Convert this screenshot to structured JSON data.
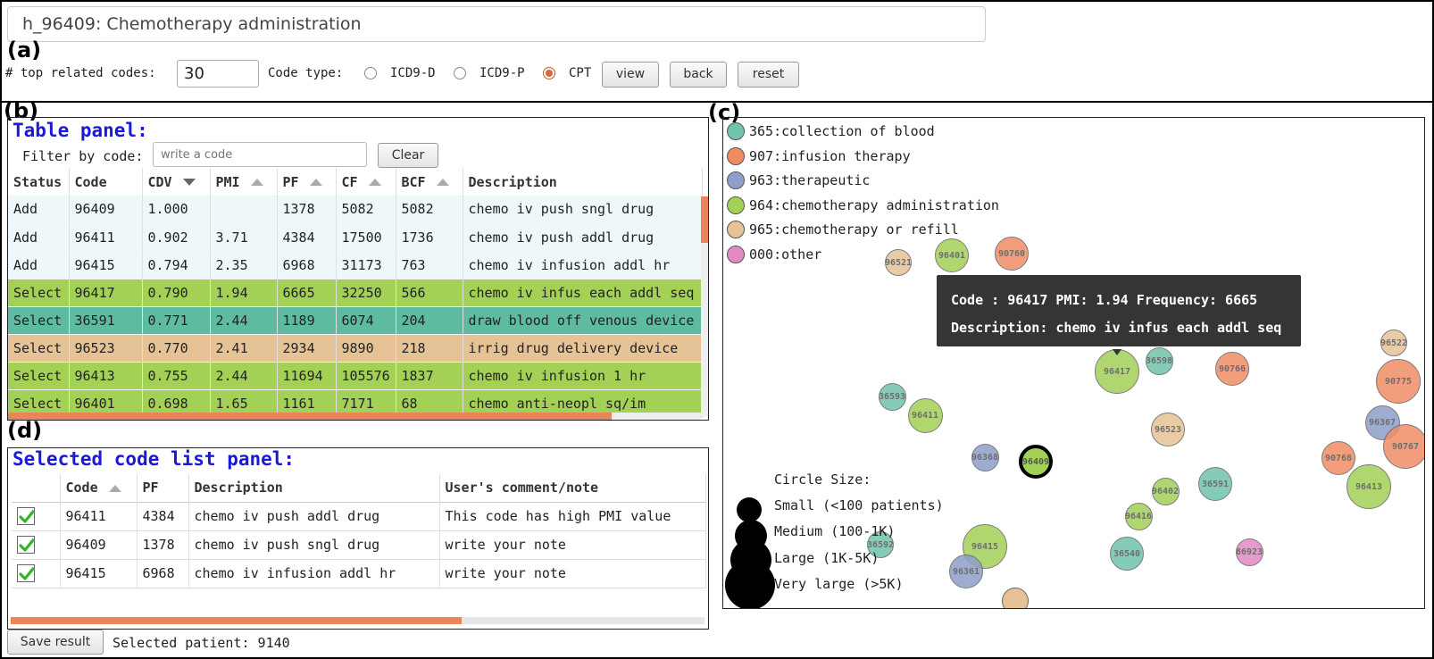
{
  "concept_title": "h_96409: Chemotherapy administration",
  "panel_letters": {
    "a": "(a)",
    "b": "(b)",
    "c": "(c)",
    "d": "(d)"
  },
  "controls": {
    "top_codes_label": "# top related codes:",
    "top_codes_value": "30",
    "code_type_label": "Code type:",
    "code_types": [
      "ICD9-D",
      "ICD9-P",
      "CPT"
    ],
    "selected_code_type": "CPT",
    "view_button": "view",
    "back_button": "back",
    "reset_button": "reset"
  },
  "table_panel": {
    "title": "Table panel:",
    "filter_label": "Filter by code:",
    "filter_placeholder": "write a code",
    "clear_button": "Clear",
    "columns": [
      "Status",
      "Code",
      "CDV",
      "PMI",
      "PF",
      "CF",
      "BCF",
      "Description"
    ],
    "sort_column": "CDV",
    "sort_direction": "descending",
    "rows": [
      {
        "status": "Add",
        "code": "96409",
        "cdv": "1.000",
        "pmi": "",
        "pf": "1378",
        "cf": "5082",
        "bcf": "5082",
        "description": "chemo iv push sngl drug",
        "color": "#eef7fa"
      },
      {
        "status": "Add",
        "code": "96411",
        "cdv": "0.902",
        "pmi": "3.71",
        "pf": "4384",
        "cf": "17500",
        "bcf": "1736",
        "description": "chemo iv push addl drug",
        "color": "#eef7fa"
      },
      {
        "status": "Add",
        "code": "96415",
        "cdv": "0.794",
        "pmi": "2.35",
        "pf": "6968",
        "cf": "31173",
        "bcf": "763",
        "description": "chemo iv infusion addl hr",
        "color": "#eef7fa"
      },
      {
        "status": "Select",
        "code": "96417",
        "cdv": "0.790",
        "pmi": "1.94",
        "pf": "6665",
        "cf": "32250",
        "bcf": "566",
        "description": "chemo iv infus each addl seq",
        "color": "#a3d156"
      },
      {
        "status": "Select",
        "code": "36591",
        "cdv": "0.771",
        "pmi": "2.44",
        "pf": "1189",
        "cf": "6074",
        "bcf": "204",
        "description": "draw blood off venous device",
        "color": "#5fbaa2"
      },
      {
        "status": "Select",
        "code": "96523",
        "cdv": "0.770",
        "pmi": "2.41",
        "pf": "2934",
        "cf": "9890",
        "bcf": "218",
        "description": "irrig drug delivery device",
        "color": "#e6c396"
      },
      {
        "status": "Select",
        "code": "96413",
        "cdv": "0.755",
        "pmi": "2.44",
        "pf": "11694",
        "cf": "105576",
        "bcf": "1837",
        "description": "chemo iv infusion 1 hr",
        "color": "#a3d156"
      },
      {
        "status": "Select",
        "code": "96401",
        "cdv": "0.698",
        "pmi": "1.65",
        "pf": "1161",
        "cf": "7171",
        "bcf": "68",
        "description": "chemo anti-neopl sq/im",
        "color": "#a3d156"
      }
    ]
  },
  "selected_panel": {
    "title": "Selected code list panel:",
    "columns": [
      "Code",
      "PF",
      "Description",
      "User's comment/note"
    ],
    "rows": [
      {
        "checked": true,
        "code": "96411",
        "pf": "4384",
        "description": "chemo iv push addl drug",
        "note": "This code has high PMI value"
      },
      {
        "checked": true,
        "code": "96409",
        "pf": "1378",
        "description": "chemo iv push sngl drug",
        "note": "write your note"
      },
      {
        "checked": true,
        "code": "96415",
        "pf": "6968",
        "description": "chemo iv infusion addl hr",
        "note": "write your note"
      }
    ],
    "save_button": "Save result",
    "selected_patient": "Selected patient: 9140"
  },
  "visualization": {
    "legend": [
      {
        "label": "365:collection of blood",
        "color": "#6fc4ab"
      },
      {
        "label": "907:infusion therapy",
        "color": "#f08c64"
      },
      {
        "label": "963:therapeutic",
        "color": "#8e9ecb"
      },
      {
        "label": "964:chemotherapy administration",
        "color": "#a3d156"
      },
      {
        "label": "965:chemotherapy or refill",
        "color": "#e6c396"
      },
      {
        "label": "000:other",
        "color": "#e38ac4"
      }
    ],
    "size_legend": {
      "title": "Circle Size:",
      "items": [
        "Small (<100 patients)",
        "Medium (100-1K)",
        "Large (1K-5K)",
        "Very large (>5K)"
      ]
    },
    "bubbles": [
      {
        "code": "96521",
        "group": "965"
      },
      {
        "code": "96401",
        "group": "964"
      },
      {
        "code": "90760",
        "group": "907"
      },
      {
        "code": "96522",
        "group": "965"
      },
      {
        "code": "96417",
        "group": "964"
      },
      {
        "code": "36598",
        "group": "365"
      },
      {
        "code": "90766",
        "group": "907"
      },
      {
        "code": "90775",
        "group": "907"
      },
      {
        "code": "36593",
        "group": "365"
      },
      {
        "code": "96411",
        "group": "964"
      },
      {
        "code": "96523",
        "group": "965"
      },
      {
        "code": "96367",
        "group": "963"
      },
      {
        "code": "90767",
        "group": "907"
      },
      {
        "code": "96368",
        "group": "963"
      },
      {
        "code": "96409",
        "group": "964"
      },
      {
        "code": "90768",
        "group": "907"
      },
      {
        "code": "96413",
        "group": "964"
      },
      {
        "code": "96402",
        "group": "964"
      },
      {
        "code": "36591",
        "group": "365"
      },
      {
        "code": "96416",
        "group": "964"
      },
      {
        "code": "96415",
        "group": "964"
      },
      {
        "code": "36592",
        "group": "365"
      },
      {
        "code": "36540",
        "group": "365"
      },
      {
        "code": "86923",
        "group": "000"
      },
      {
        "code": "96361",
        "group": "963"
      }
    ],
    "highlighted_code": "96409",
    "tooltip": {
      "line1": "Code : 96417 PMI: 1.94 Frequency: 6665",
      "line2": "Description: chemo iv infus each addl seq"
    }
  }
}
